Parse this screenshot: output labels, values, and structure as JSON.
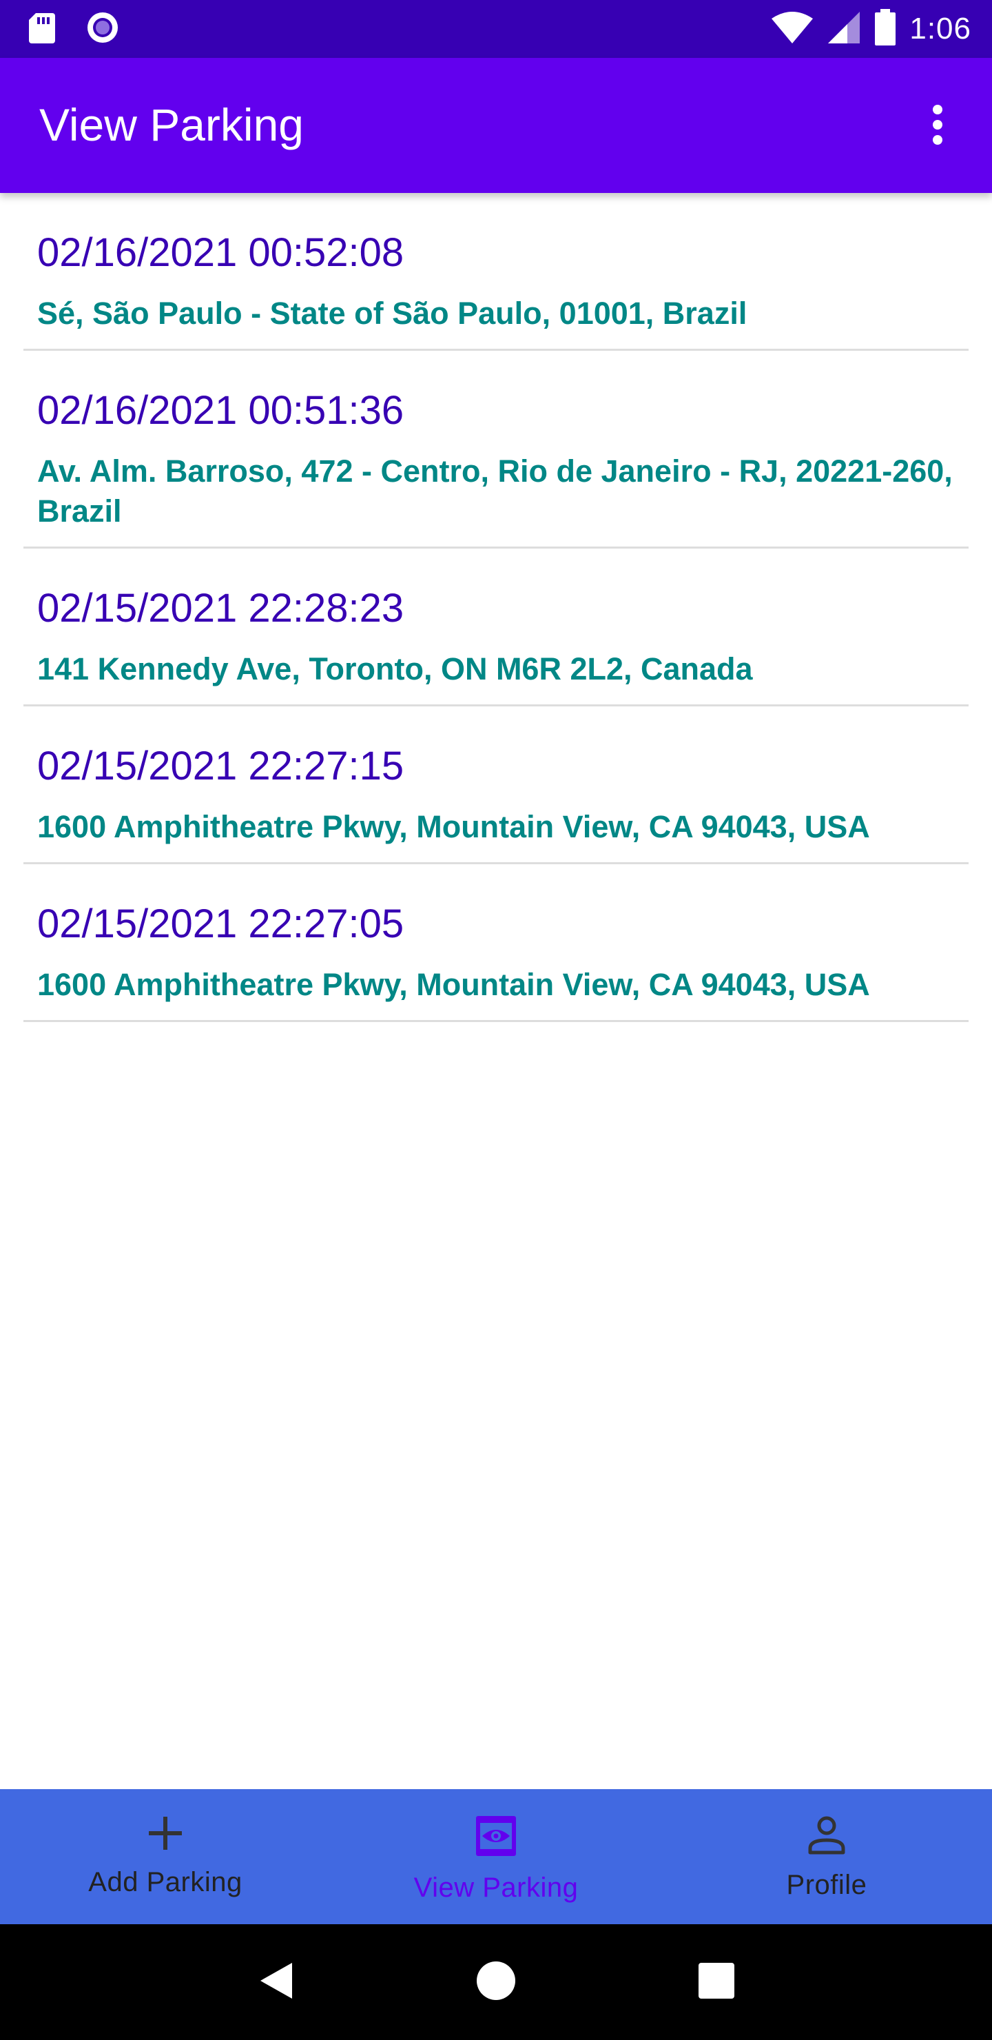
{
  "status_bar": {
    "time": "1:06",
    "icons": [
      "sd-card-icon",
      "radio-button-icon",
      "wifi-icon",
      "signal-icon",
      "battery-icon"
    ]
  },
  "app_bar": {
    "title": "View Parking",
    "menu_icon": "more-vert-icon"
  },
  "parking_list": [
    {
      "datetime": "02/16/2021 00:52:08",
      "address": "Sé, São Paulo - State of São Paulo, 01001, Brazil"
    },
    {
      "datetime": "02/16/2021 00:51:36",
      "address": "Av. Alm. Barroso, 472 - Centro, Rio de Janeiro - RJ, 20221-260, Brazil"
    },
    {
      "datetime": "02/15/2021 22:28:23",
      "address": "141 Kennedy Ave, Toronto, ON M6R 2L2, Canada"
    },
    {
      "datetime": "02/15/2021 22:27:15",
      "address": "1600 Amphitheatre Pkwy, Mountain View, CA 94043, USA"
    },
    {
      "datetime": "02/15/2021 22:27:05",
      "address": "1600 Amphitheatre Pkwy, Mountain View, CA 94043, USA"
    }
  ],
  "bottom_nav": {
    "items": [
      {
        "label": "Add Parking",
        "icon": "add-icon"
      },
      {
        "label": "View Parking",
        "icon": "view-icon",
        "active": true
      },
      {
        "label": "Profile",
        "icon": "person-icon"
      }
    ]
  },
  "system_nav": [
    "back-icon",
    "home-icon",
    "recents-icon"
  ],
  "colors": {
    "status_bar": "#3700b3",
    "app_bar": "#6200ee",
    "datetime": "#3700b3",
    "address": "#018786",
    "bottom_nav": "#4169e1",
    "nav_active": "#6200ee"
  }
}
